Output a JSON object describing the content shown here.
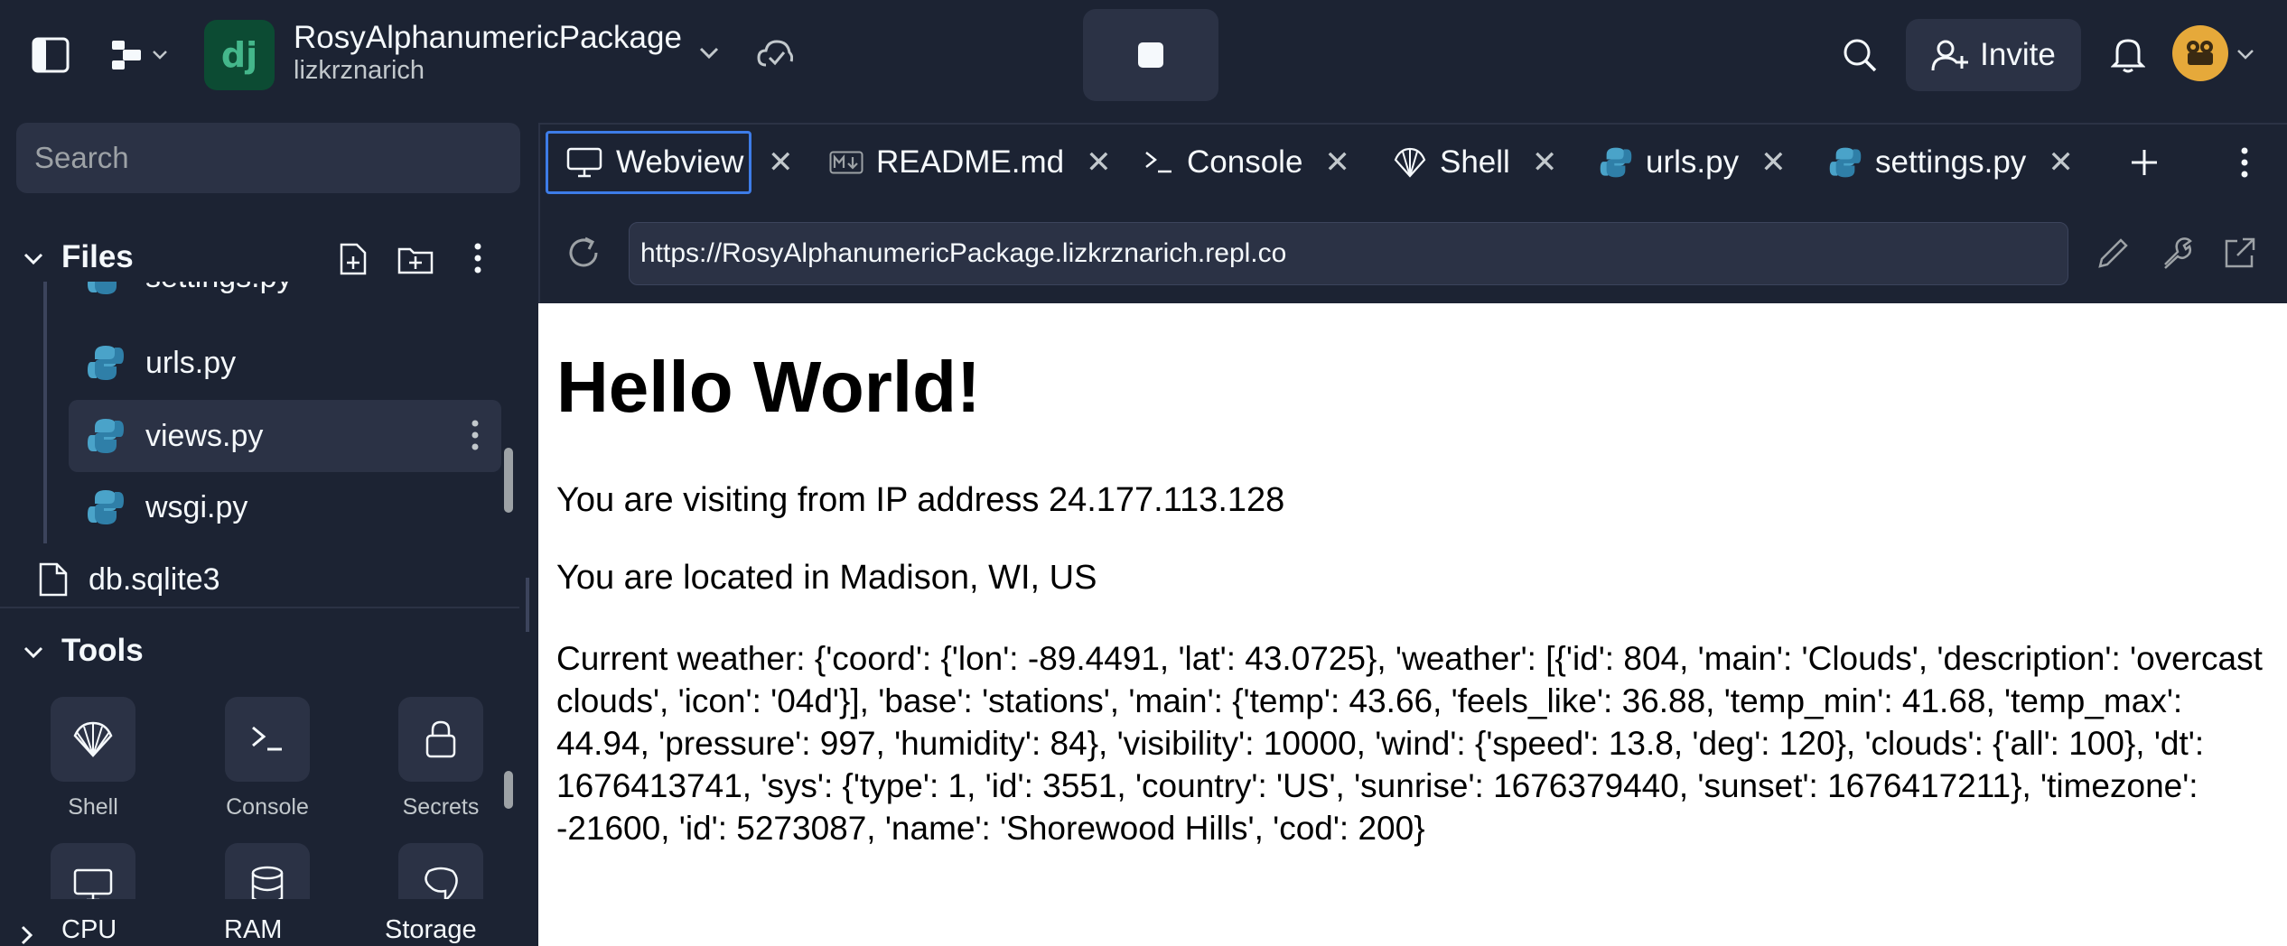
{
  "app": {
    "repl_name": "RosyAlphanumericPackage",
    "owner": "lizkrznarich",
    "logo_text": "dj",
    "invite_label": "Invite"
  },
  "sidebar": {
    "search_placeholder": "Search",
    "files_label": "Files",
    "files": [
      {
        "name": "settings.py",
        "icon": "python-icon"
      },
      {
        "name": "urls.py",
        "icon": "python-icon"
      },
      {
        "name": "views.py",
        "icon": "python-icon",
        "selected": true
      },
      {
        "name": "wsgi.py",
        "icon": "python-icon"
      },
      {
        "name": "db.sqlite3",
        "icon": "file-icon"
      }
    ],
    "tools_label": "Tools",
    "tools": [
      {
        "label": "Shell",
        "icon": "shell-icon"
      },
      {
        "label": "Console",
        "icon": "console-icon"
      },
      {
        "label": "Secrets",
        "icon": "lock-icon"
      }
    ],
    "resources": [
      "CPU",
      "RAM",
      "Storage"
    ]
  },
  "tabs": [
    {
      "label": "Webview",
      "icon": "monitor-icon",
      "active": true
    },
    {
      "label": "README.md",
      "icon": "markdown-icon"
    },
    {
      "label": "Console",
      "icon": "console-icon"
    },
    {
      "label": "Shell",
      "icon": "shell-icon"
    },
    {
      "label": "urls.py",
      "icon": "python-icon"
    },
    {
      "label": "settings.py",
      "icon": "python-icon"
    }
  ],
  "webview": {
    "url": "https://RosyAlphanumericPackage.lizkrznarich.repl.co",
    "title": "Hello World!",
    "ip_line": "You are visiting from IP address 24.177.113.128",
    "location_line": "You are located in Madison, WI, US",
    "weather_line": "Current weather: {'coord': {'lon': -89.4491, 'lat': 43.0725}, 'weather': [{'id': 804, 'main': 'Clouds', 'description': 'overcast clouds', 'icon': '04d'}], 'base': 'stations', 'main': {'temp': 43.66, 'feels_like': 36.88, 'temp_min': 41.68, 'temp_max': 44.94, 'pressure': 997, 'humidity': 84}, 'visibility': 10000, 'wind': {'speed': 13.8, 'deg': 120}, 'clouds': {'all': 100}, 'dt': 1676413741, 'sys': {'type': 1, 'id': 3551, 'country': 'US', 'sunrise': 1676379440, 'sunset': 1676417211}, 'timezone': -21600, 'id': 5273087, 'name': 'Shorewood Hills', 'cod': 200}"
  },
  "colors": {
    "background": "#1c2333",
    "surface": "#2b3245",
    "accent": "#3d7ce8",
    "python": "#4aa3c9"
  }
}
